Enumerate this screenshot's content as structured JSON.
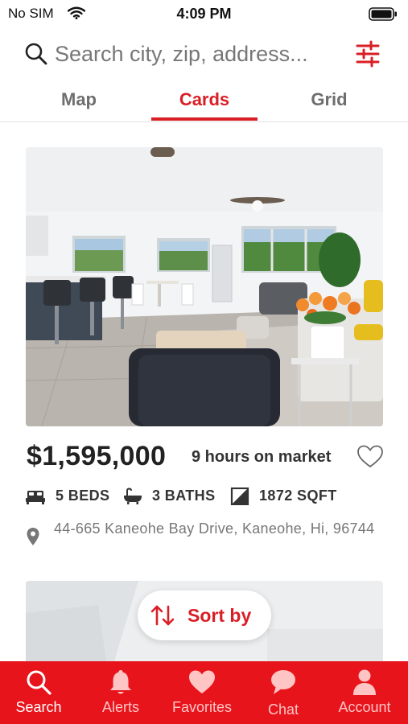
{
  "status": {
    "carrier": "No SIM",
    "time": "4:09 PM"
  },
  "search": {
    "placeholder": "Search city, zip, address..."
  },
  "tabs": [
    {
      "label": "Map",
      "selected": false
    },
    {
      "label": "Cards",
      "selected": true
    },
    {
      "label": "Grid",
      "selected": false
    }
  ],
  "listing": {
    "price": "$1,595,000",
    "market_time": "9 hours on market",
    "beds": "5 BEDS",
    "baths": "3 BATHS",
    "sqft": "1872 SQFT",
    "address": "44-665 Kaneohe Bay Drive, Kaneohe, Hi, 96744",
    "favorited": false
  },
  "sort": {
    "label": "Sort by"
  },
  "bottom_nav": [
    {
      "label": "Search",
      "icon": "search-icon",
      "active": true
    },
    {
      "label": "Alerts",
      "icon": "bell-icon",
      "active": false
    },
    {
      "label": "Favorites",
      "icon": "heart-icon",
      "active": false
    },
    {
      "label": "Chat",
      "icon": "chat-icon",
      "active": false
    },
    {
      "label": "Account",
      "icon": "person-icon",
      "active": false
    }
  ],
  "colors": {
    "accent": "#d91f26",
    "nav_background": "#e8141c"
  }
}
